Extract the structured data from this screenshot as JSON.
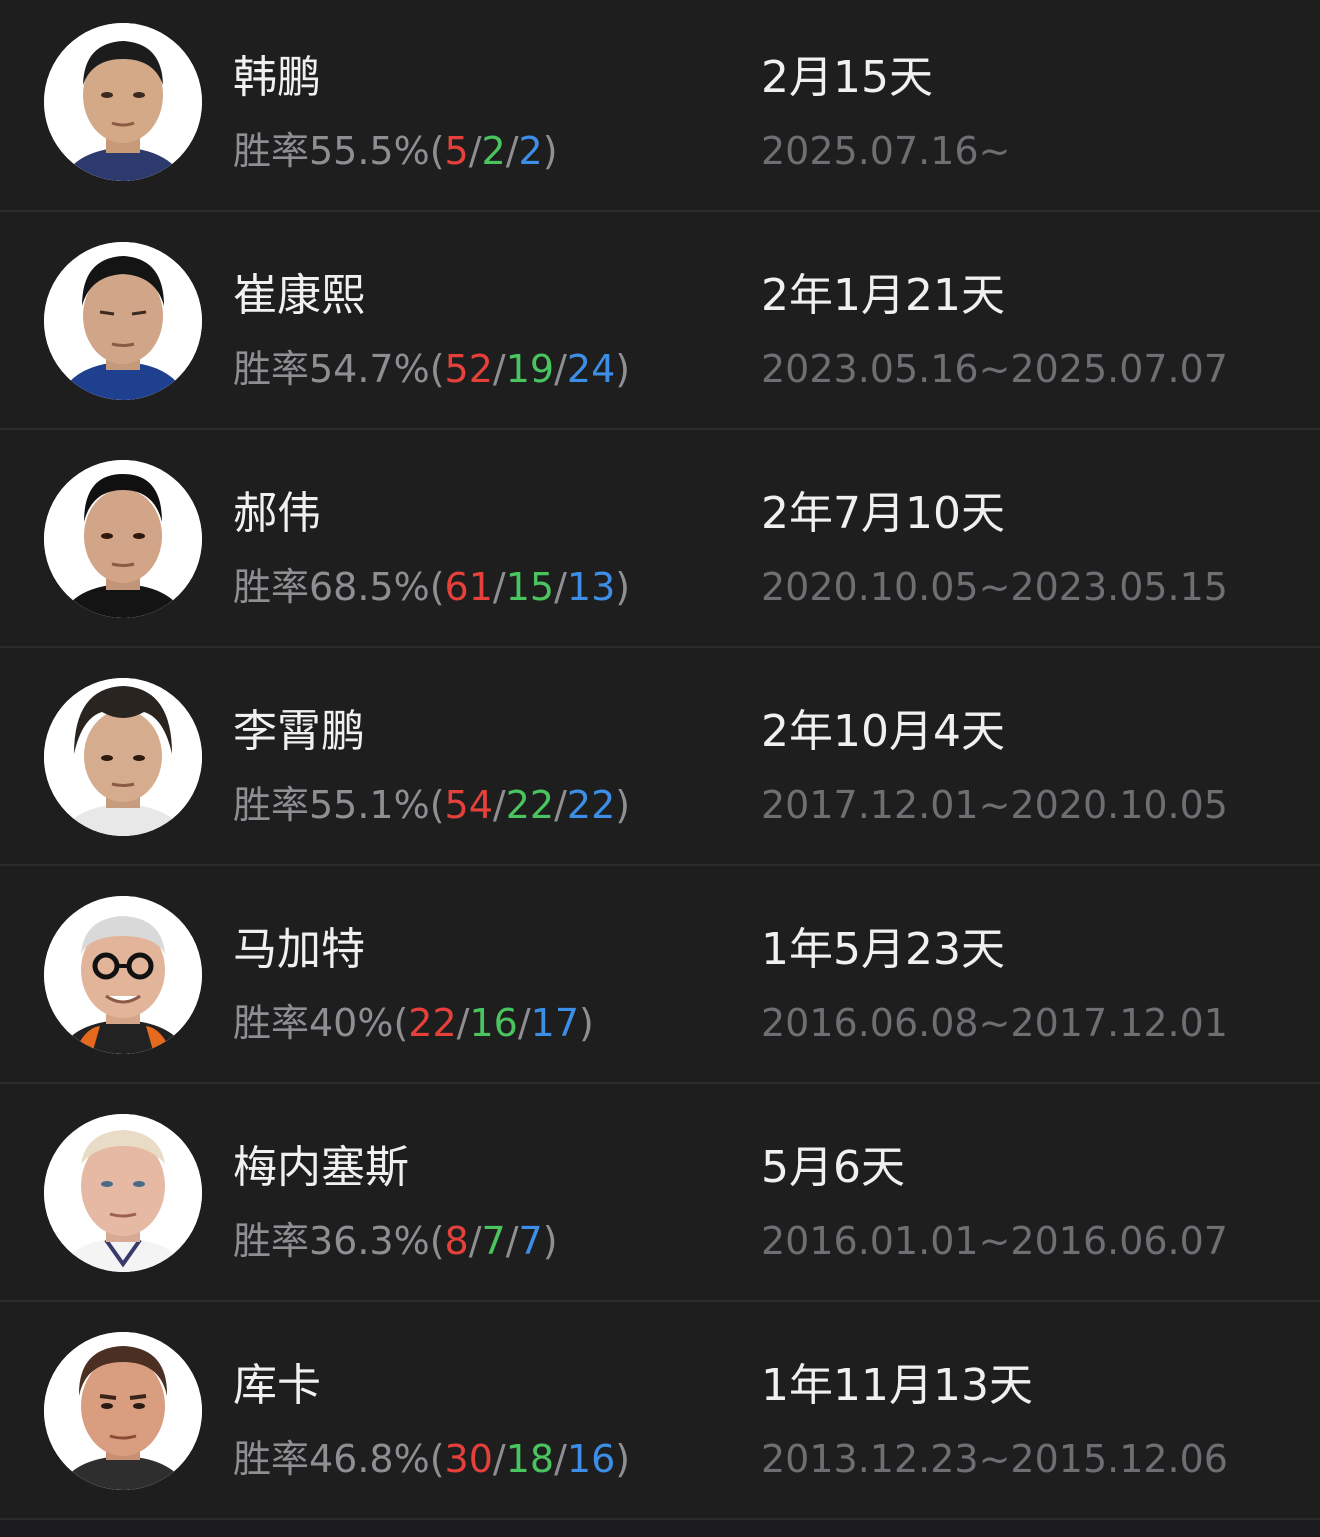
{
  "coaches": [
    {
      "name": "韩鹏",
      "rate_label": "胜率55.5%(",
      "wins": "5",
      "draws": "2",
      "losses": "2",
      "tenure": "2月15天",
      "dates": "2025.07.16~",
      "avatar": "coach-photo"
    },
    {
      "name": "崔康熙",
      "rate_label": "胜率54.7%(",
      "wins": "52",
      "draws": "19",
      "losses": "24",
      "tenure": "2年1月21天",
      "dates": "2023.05.16~2025.07.07",
      "avatar": "coach-photo"
    },
    {
      "name": "郝伟",
      "rate_label": "胜率68.5%(",
      "wins": "61",
      "draws": "15",
      "losses": "13",
      "tenure": "2年7月10天",
      "dates": "2020.10.05~2023.05.15",
      "avatar": "coach-photo"
    },
    {
      "name": "李霄鹏",
      "rate_label": "胜率55.1%(",
      "wins": "54",
      "draws": "22",
      "losses": "22",
      "tenure": "2年10月4天",
      "dates": "2017.12.01~2020.10.05",
      "avatar": "coach-photo"
    },
    {
      "name": "马加特",
      "rate_label": "胜率40%(",
      "wins": "22",
      "draws": "16",
      "losses": "17",
      "tenure": "1年5月23天",
      "dates": "2016.06.08~2017.12.01",
      "avatar": "coach-photo"
    },
    {
      "name": "梅内塞斯",
      "rate_label": "胜率36.3%(",
      "wins": "8",
      "draws": "7",
      "losses": "7",
      "tenure": "5月6天",
      "dates": "2016.01.01~2016.06.07",
      "avatar": "coach-photo"
    },
    {
      "name": "库卡",
      "rate_label": "胜率46.8%(",
      "wins": "30",
      "draws": "18",
      "losses": "16",
      "tenure": "1年11月13天",
      "dates": "2013.12.23~2015.12.06",
      "avatar": "coach-photo"
    }
  ],
  "separator": "/",
  "close_paren": ")",
  "colors": {
    "background": "#1c1c1e",
    "wins": "#e5413a",
    "draws": "#4ac45e",
    "losses": "#3d8ee6",
    "secondary_text": "#8e8e93"
  }
}
